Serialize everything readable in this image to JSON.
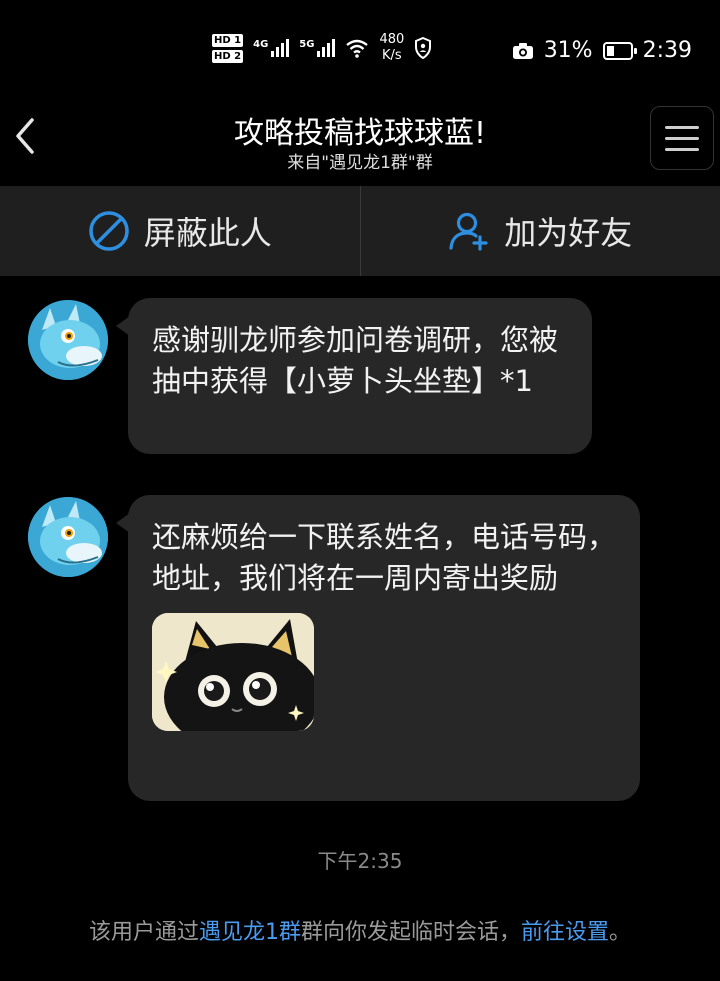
{
  "status_bar": {
    "hd1": "HD 1",
    "hd2": "HD 2",
    "net1": "4G",
    "net2": "5G",
    "speed_value": "480",
    "speed_unit": "K/s",
    "battery_pct": "31%",
    "battery_level": 0.31,
    "time": "2:39"
  },
  "header": {
    "title": "攻略投稿找球球蓝!",
    "subtitle": "来自\"遇见龙1群\"群"
  },
  "actions": {
    "block_label": "屏蔽此人",
    "add_friend_label": "加为好友"
  },
  "messages": [
    {
      "text": "感谢驯龙师参加问卷调研，您被抽中获得【小萝卜头坐垫】*1"
    },
    {
      "text": "还麻烦给一下联系姓名，电话号码，地址，我们将在一周内寄出奖励"
    }
  ],
  "timestamp": "下午2:35",
  "notice": {
    "prefix": "该用户通过",
    "group_link": "遇见龙1群",
    "middle": "群向你发起临时会话，",
    "settings_link": "前往设置",
    "suffix": "。"
  },
  "colors": {
    "background": "#000000",
    "bubble": "#272727",
    "link": "#4a9cf0",
    "accent_icon": "#2e8fe0"
  }
}
